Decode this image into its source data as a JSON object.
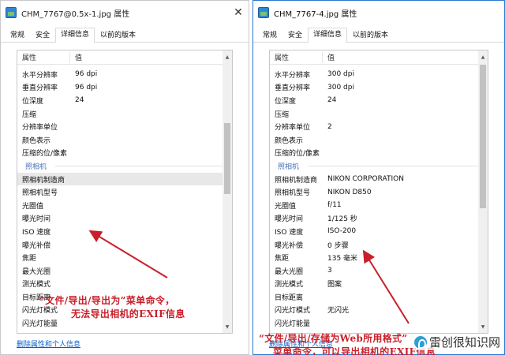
{
  "left_window": {
    "title": "CHM_7767@0.5x-1.jpg 属性",
    "tabs": [
      "常规",
      "安全",
      "详细信息",
      "以前的版本"
    ],
    "active_tab": "详细信息",
    "header": {
      "name": "属性",
      "value": "值"
    },
    "rows": [
      {
        "k": "水平分辨率",
        "v": "96 dpi"
      },
      {
        "k": "垂直分辨率",
        "v": "96 dpi"
      },
      {
        "k": "位深度",
        "v": "24"
      },
      {
        "k": "压缩",
        "v": ""
      },
      {
        "k": "分辨率单位",
        "v": ""
      },
      {
        "k": "颜色表示",
        "v": ""
      },
      {
        "k": "压缩的位/像素",
        "v": ""
      },
      {
        "k": "照相机",
        "v": "",
        "group": true
      },
      {
        "k": "照相机制造商",
        "v": "",
        "hl": true
      },
      {
        "k": "照相机型号",
        "v": ""
      },
      {
        "k": "光圈值",
        "v": ""
      },
      {
        "k": "曝光时间",
        "v": ""
      },
      {
        "k": "ISO 速度",
        "v": ""
      },
      {
        "k": "曝光补偿",
        "v": ""
      },
      {
        "k": "焦距",
        "v": ""
      },
      {
        "k": "最大光圈",
        "v": ""
      },
      {
        "k": "测光模式",
        "v": ""
      },
      {
        "k": "目标距离",
        "v": ""
      },
      {
        "k": "闪光灯模式",
        "v": ""
      },
      {
        "k": "闪光灯能量",
        "v": ""
      }
    ],
    "remove_link": "删除属性和个人信息"
  },
  "right_window": {
    "title": "CHM_7767-4.jpg 属性",
    "tabs": [
      "常规",
      "安全",
      "详细信息",
      "以前的版本"
    ],
    "active_tab": "详细信息",
    "header": {
      "name": "属性",
      "value": "值"
    },
    "rows": [
      {
        "k": "水平分辨率",
        "v": "300 dpi"
      },
      {
        "k": "垂直分辨率",
        "v": "300 dpi"
      },
      {
        "k": "位深度",
        "v": "24"
      },
      {
        "k": "压缩",
        "v": ""
      },
      {
        "k": "分辨率单位",
        "v": "2"
      },
      {
        "k": "颜色表示",
        "v": ""
      },
      {
        "k": "压缩的位/像素",
        "v": ""
      },
      {
        "k": "照相机",
        "v": "",
        "group": true
      },
      {
        "k": "照相机制造商",
        "v": "NIKON CORPORATION"
      },
      {
        "k": "照相机型号",
        "v": "NIKON D850"
      },
      {
        "k": "光圈值",
        "v": "f/11"
      },
      {
        "k": "曝光时间",
        "v": "1/125 秒"
      },
      {
        "k": "ISO 速度",
        "v": "ISO-200"
      },
      {
        "k": "曝光补偿",
        "v": "0 步骤"
      },
      {
        "k": "焦距",
        "v": "135 毫米"
      },
      {
        "k": "最大光圈",
        "v": "3"
      },
      {
        "k": "测光模式",
        "v": "图案"
      },
      {
        "k": "目标距离",
        "v": ""
      },
      {
        "k": "闪光灯模式",
        "v": "无闪光"
      },
      {
        "k": "闪光灯能量",
        "v": ""
      }
    ],
    "remove_link": "删除属性和个人信息"
  },
  "annotations": {
    "left_line1": "“文件/导出/导出为”菜单命令，",
    "left_line2": "无法导出相机的EXIF信息",
    "right_line1": "“文件/导出/存储为Web所用格式”",
    "right_line2": "菜单命令，可以导出相机的EXIF信息"
  },
  "watermark": "雷创很知识网",
  "colors": {
    "annotation": "#c8202a",
    "link": "#0a5fc7",
    "group_label": "#4a76b8",
    "active_border": "#2b79d0"
  }
}
